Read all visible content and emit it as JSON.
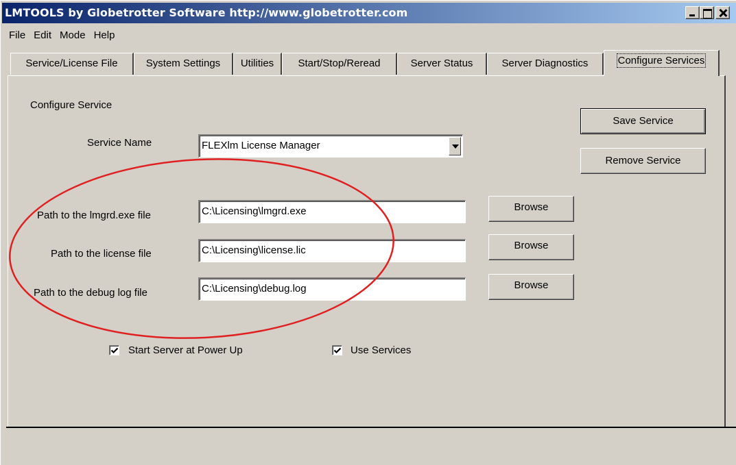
{
  "window": {
    "title": "LMTOOLS by Globetrotter Software http://www.globetrotter.com",
    "title_bar_color": "#0a246a"
  },
  "menu": [
    "File",
    "Edit",
    "Mode",
    "Help"
  ],
  "tabs": [
    {
      "label": "Service/License File",
      "active": false
    },
    {
      "label": "System Settings",
      "active": false
    },
    {
      "label": "Utilities",
      "active": false
    },
    {
      "label": "Start/Stop/Reread",
      "active": false
    },
    {
      "label": "Server Status",
      "active": false
    },
    {
      "label": "Server Diagnostics",
      "active": false
    },
    {
      "label": "Configure Services",
      "active": true
    }
  ],
  "configure": {
    "heading": "Configure Service",
    "service_name_label": "Service Name",
    "service_name_value": "FLEXlm License Manager",
    "lmgrd_label": "Path to the lmgrd.exe file",
    "lmgrd_value": "C:\\Licensing\\lmgrd.exe",
    "license_label": "Path to the license file",
    "license_value": "C:\\Licensing\\license.lic",
    "debug_label": "Path to the debug log file",
    "debug_value": "C:\\Licensing\\debug.log",
    "browse_label": "Browse",
    "save_label": "Save Service",
    "remove_label": "Remove Service",
    "start_at_powerup_label": "Start Server at Power Up",
    "start_at_powerup_checked": true,
    "use_services_label": "Use Services",
    "use_services_checked": true
  },
  "annotation": {
    "shape": "ellipse",
    "color": "#e02020"
  }
}
